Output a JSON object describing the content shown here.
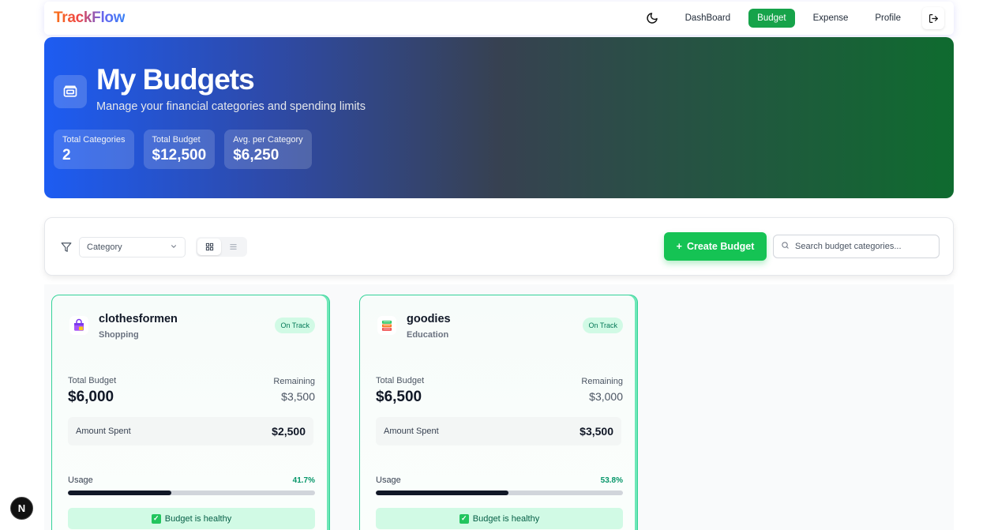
{
  "brand": "TrackFlow",
  "nav": {
    "links": [
      {
        "label": "DashBoard",
        "active": false
      },
      {
        "label": "Budget",
        "active": true
      },
      {
        "label": "Expense",
        "active": false
      },
      {
        "label": "Profile",
        "active": false
      }
    ]
  },
  "hero": {
    "title": "My Budgets",
    "subtitle": "Manage your financial categories and spending limits",
    "stats": [
      {
        "label": "Total Categories",
        "value": "2"
      },
      {
        "label": "Total Budget",
        "value": "$12,500"
      },
      {
        "label": "Avg. per Category",
        "value": "$6,250"
      }
    ]
  },
  "toolbar": {
    "category_select": "Category",
    "create_label": "Create Budget",
    "create_plus": "+",
    "search_placeholder": "Search budget categories..."
  },
  "cards": [
    {
      "name": "clothesformen",
      "category": "Shopping",
      "status": "On Track",
      "total_budget_label": "Total Budget",
      "total_budget": "$6,000",
      "remaining_label": "Remaining",
      "remaining": "$3,500",
      "spent_label": "Amount Spent",
      "spent": "$2,500",
      "usage_label": "Usage",
      "usage_pct": "41.7%",
      "usage_fraction": 0.417,
      "health_text": "Budget is healthy",
      "icon": "shopping-bag-icon"
    },
    {
      "name": "goodies",
      "category": "Education",
      "status": "On Track",
      "total_budget_label": "Total Budget",
      "total_budget": "$6,500",
      "remaining_label": "Remaining",
      "remaining": "$3,000",
      "spent_label": "Amount Spent",
      "spent": "$3,500",
      "usage_label": "Usage",
      "usage_pct": "53.8%",
      "usage_fraction": 0.538,
      "health_text": "Budget is healthy",
      "icon": "books-icon"
    }
  ],
  "colors": {
    "accent_green": "#16a34a",
    "create_green": "#15c354",
    "hero_start": "#1d5cf2",
    "hero_end": "#0f6b2f"
  },
  "next_badge": "N"
}
